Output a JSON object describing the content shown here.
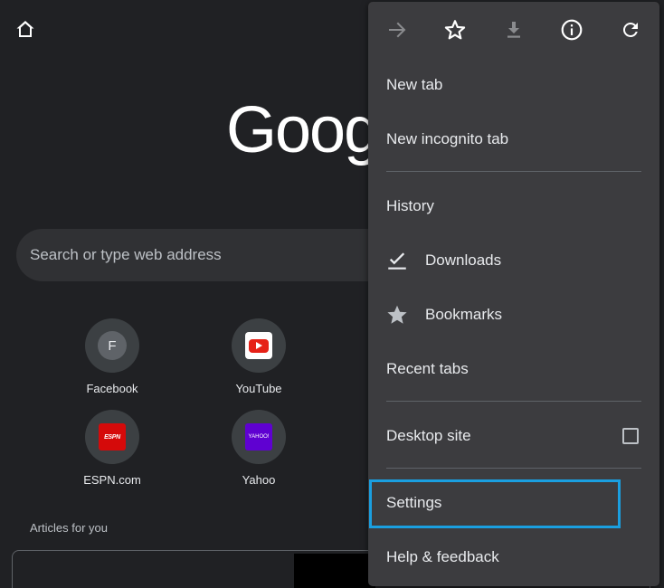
{
  "ntp": {
    "logo_text": "Goog",
    "search_placeholder": "Search or type web address",
    "tiles": [
      {
        "label": "Facebook",
        "icon": "facebook-icon",
        "letter": "F"
      },
      {
        "label": "YouTube",
        "icon": "youtube-icon"
      },
      {
        "label": "ESPN.com",
        "icon": "espn-icon",
        "logo_text": "ESPN"
      },
      {
        "label": "Yahoo",
        "icon": "yahoo-icon",
        "logo_text": "YAHOO!"
      }
    ],
    "articles_label": "Articles for you"
  },
  "menu": {
    "toolbar": [
      {
        "name": "forward",
        "icon": "arrow-right-icon"
      },
      {
        "name": "bookmark",
        "icon": "star-outline-icon"
      },
      {
        "name": "download",
        "icon": "download-icon"
      },
      {
        "name": "page-info",
        "icon": "info-icon"
      },
      {
        "name": "reload",
        "icon": "refresh-icon"
      }
    ],
    "items": {
      "new_tab": "New tab",
      "new_incognito_tab": "New incognito tab",
      "history": "History",
      "downloads": "Downloads",
      "bookmarks": "Bookmarks",
      "recent_tabs": "Recent tabs",
      "desktop_site": "Desktop site",
      "settings": "Settings",
      "help_feedback": "Help & feedback"
    },
    "desktop_site_checked": false
  },
  "colors": {
    "background": "#202124",
    "menu_background": "#3c3c3f",
    "highlight": "#1a9fe0",
    "text": "#e8eaed"
  }
}
